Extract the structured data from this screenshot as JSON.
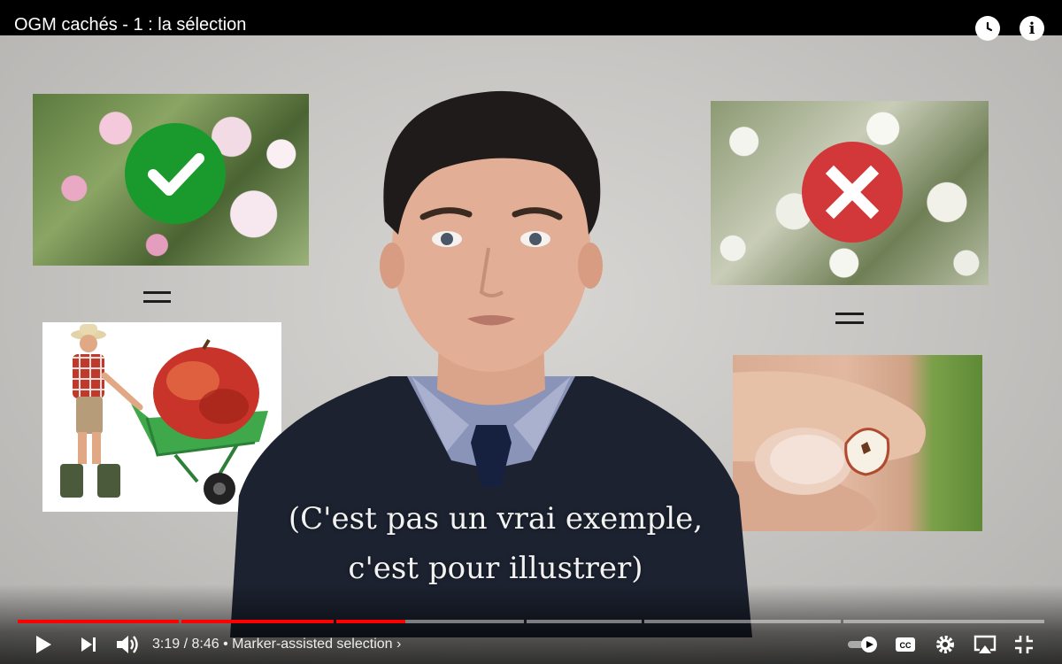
{
  "video": {
    "title": "OGM cachés - 1 : la sélection",
    "caption_line1": "(C'est pas un vrai exemple,",
    "caption_line2": "c'est pour illustrer)"
  },
  "top_bar": {
    "icons": [
      "watch-later-icon",
      "info-icon"
    ],
    "info_glyph": "i"
  },
  "slide": {
    "left_badge": "check-icon",
    "right_badge": "cross-icon",
    "badge_colors": {
      "check": "#1a9a2c",
      "cross": "#d2383a"
    }
  },
  "player": {
    "current_time": "3:19",
    "time_separator": "/",
    "duration": "8:46",
    "bullet": "•",
    "chapter": "Marker-assisted selection",
    "chapter_chevron": "›",
    "progress_fraction": 0.378,
    "accent_color": "#ff0000",
    "controls": [
      "play-icon",
      "next-icon",
      "volume-icon",
      "autoplay-toggle",
      "subtitles-icon",
      "settings-icon",
      "airplay-icon",
      "exit-fullscreen-icon"
    ],
    "cc_label": "CC"
  }
}
